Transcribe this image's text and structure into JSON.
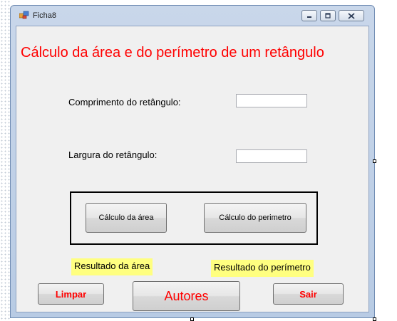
{
  "window": {
    "title": "Ficha8"
  },
  "form": {
    "heading": "Cálculo da área e do perímetro de um retângulo",
    "length_label": "Comprimento do retângulo:",
    "length_value": "",
    "width_label": "Largura do retângulo:",
    "width_value": "",
    "area_button": "Cálculo da área",
    "perimeter_button": "Cálculo do perimetro",
    "area_result": "Resultado da área",
    "perimeter_result": "Resultado do perímetro",
    "clear_button": "Limpar",
    "authors_button": "Autores",
    "exit_button": "Sair"
  },
  "colors": {
    "heading": "#ff0000",
    "result_background": "#ffff80",
    "accent_button_text": "#ff0000"
  },
  "icons": [
    "app-icon",
    "minimize-icon",
    "maximize-icon",
    "close-icon"
  ]
}
